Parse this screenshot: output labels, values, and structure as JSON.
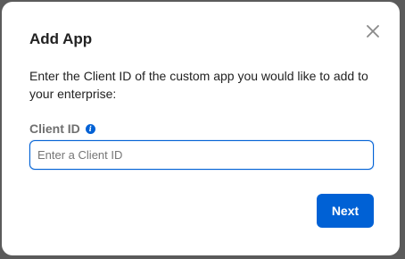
{
  "dialog": {
    "title": "Add App",
    "close_icon": "close-icon",
    "description": "Enter the Client ID of the custom app you would like to add to your enterprise:",
    "client_id": {
      "label": "Client ID",
      "info_icon": "info-icon",
      "value": "",
      "placeholder": "Enter a Client ID"
    },
    "next_label": "Next"
  },
  "colors": {
    "accent": "#0061d5",
    "backdrop": "#5b5b5b",
    "dialog_bg": "#ffffff",
    "label_gray": "#6f6f6f"
  }
}
